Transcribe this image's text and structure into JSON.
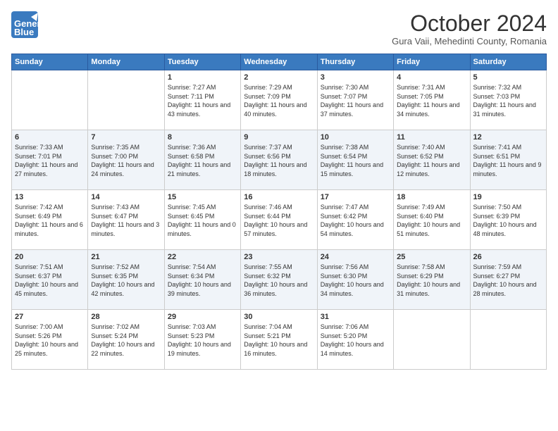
{
  "header": {
    "logo_general": "General",
    "logo_blue": "Blue",
    "month": "October 2024",
    "location": "Gura Vaii, Mehedinti County, Romania"
  },
  "weekdays": [
    "Sunday",
    "Monday",
    "Tuesday",
    "Wednesday",
    "Thursday",
    "Friday",
    "Saturday"
  ],
  "weeks": [
    [
      {
        "day": "",
        "content": ""
      },
      {
        "day": "",
        "content": ""
      },
      {
        "day": "1",
        "content": "Sunrise: 7:27 AM\nSunset: 7:11 PM\nDaylight: 11 hours and 43 minutes."
      },
      {
        "day": "2",
        "content": "Sunrise: 7:29 AM\nSunset: 7:09 PM\nDaylight: 11 hours and 40 minutes."
      },
      {
        "day": "3",
        "content": "Sunrise: 7:30 AM\nSunset: 7:07 PM\nDaylight: 11 hours and 37 minutes."
      },
      {
        "day": "4",
        "content": "Sunrise: 7:31 AM\nSunset: 7:05 PM\nDaylight: 11 hours and 34 minutes."
      },
      {
        "day": "5",
        "content": "Sunrise: 7:32 AM\nSunset: 7:03 PM\nDaylight: 11 hours and 31 minutes."
      }
    ],
    [
      {
        "day": "6",
        "content": "Sunrise: 7:33 AM\nSunset: 7:01 PM\nDaylight: 11 hours and 27 minutes."
      },
      {
        "day": "7",
        "content": "Sunrise: 7:35 AM\nSunset: 7:00 PM\nDaylight: 11 hours and 24 minutes."
      },
      {
        "day": "8",
        "content": "Sunrise: 7:36 AM\nSunset: 6:58 PM\nDaylight: 11 hours and 21 minutes."
      },
      {
        "day": "9",
        "content": "Sunrise: 7:37 AM\nSunset: 6:56 PM\nDaylight: 11 hours and 18 minutes."
      },
      {
        "day": "10",
        "content": "Sunrise: 7:38 AM\nSunset: 6:54 PM\nDaylight: 11 hours and 15 minutes."
      },
      {
        "day": "11",
        "content": "Sunrise: 7:40 AM\nSunset: 6:52 PM\nDaylight: 11 hours and 12 minutes."
      },
      {
        "day": "12",
        "content": "Sunrise: 7:41 AM\nSunset: 6:51 PM\nDaylight: 11 hours and 9 minutes."
      }
    ],
    [
      {
        "day": "13",
        "content": "Sunrise: 7:42 AM\nSunset: 6:49 PM\nDaylight: 11 hours and 6 minutes."
      },
      {
        "day": "14",
        "content": "Sunrise: 7:43 AM\nSunset: 6:47 PM\nDaylight: 11 hours and 3 minutes."
      },
      {
        "day": "15",
        "content": "Sunrise: 7:45 AM\nSunset: 6:45 PM\nDaylight: 11 hours and 0 minutes."
      },
      {
        "day": "16",
        "content": "Sunrise: 7:46 AM\nSunset: 6:44 PM\nDaylight: 10 hours and 57 minutes."
      },
      {
        "day": "17",
        "content": "Sunrise: 7:47 AM\nSunset: 6:42 PM\nDaylight: 10 hours and 54 minutes."
      },
      {
        "day": "18",
        "content": "Sunrise: 7:49 AM\nSunset: 6:40 PM\nDaylight: 10 hours and 51 minutes."
      },
      {
        "day": "19",
        "content": "Sunrise: 7:50 AM\nSunset: 6:39 PM\nDaylight: 10 hours and 48 minutes."
      }
    ],
    [
      {
        "day": "20",
        "content": "Sunrise: 7:51 AM\nSunset: 6:37 PM\nDaylight: 10 hours and 45 minutes."
      },
      {
        "day": "21",
        "content": "Sunrise: 7:52 AM\nSunset: 6:35 PM\nDaylight: 10 hours and 42 minutes."
      },
      {
        "day": "22",
        "content": "Sunrise: 7:54 AM\nSunset: 6:34 PM\nDaylight: 10 hours and 39 minutes."
      },
      {
        "day": "23",
        "content": "Sunrise: 7:55 AM\nSunset: 6:32 PM\nDaylight: 10 hours and 36 minutes."
      },
      {
        "day": "24",
        "content": "Sunrise: 7:56 AM\nSunset: 6:30 PM\nDaylight: 10 hours and 34 minutes."
      },
      {
        "day": "25",
        "content": "Sunrise: 7:58 AM\nSunset: 6:29 PM\nDaylight: 10 hours and 31 minutes."
      },
      {
        "day": "26",
        "content": "Sunrise: 7:59 AM\nSunset: 6:27 PM\nDaylight: 10 hours and 28 minutes."
      }
    ],
    [
      {
        "day": "27",
        "content": "Sunrise: 7:00 AM\nSunset: 5:26 PM\nDaylight: 10 hours and 25 minutes."
      },
      {
        "day": "28",
        "content": "Sunrise: 7:02 AM\nSunset: 5:24 PM\nDaylight: 10 hours and 22 minutes."
      },
      {
        "day": "29",
        "content": "Sunrise: 7:03 AM\nSunset: 5:23 PM\nDaylight: 10 hours and 19 minutes."
      },
      {
        "day": "30",
        "content": "Sunrise: 7:04 AM\nSunset: 5:21 PM\nDaylight: 10 hours and 16 minutes."
      },
      {
        "day": "31",
        "content": "Sunrise: 7:06 AM\nSunset: 5:20 PM\nDaylight: 10 hours and 14 minutes."
      },
      {
        "day": "",
        "content": ""
      },
      {
        "day": "",
        "content": ""
      }
    ]
  ]
}
